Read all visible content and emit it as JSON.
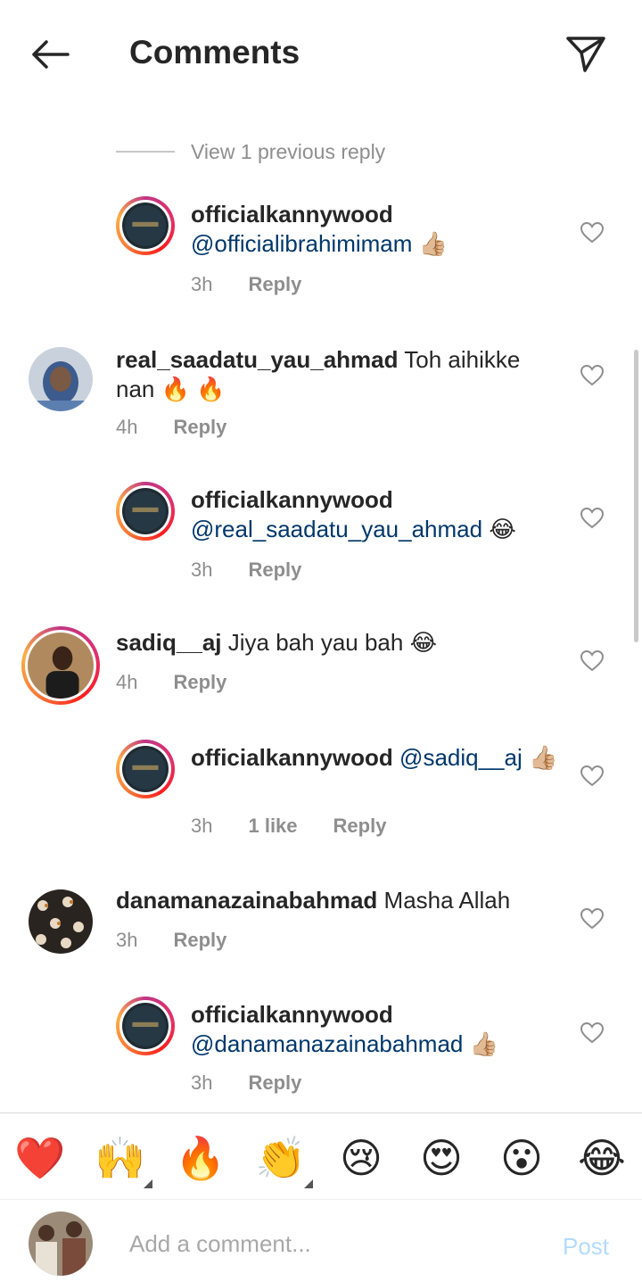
{
  "header": {
    "title": "Comments",
    "back_icon": "arrow-left-icon",
    "share_icon": "paper-plane-icon"
  },
  "view_previous": "View 1 previous reply",
  "comments": [
    {
      "username": "officialkannywood",
      "text": "",
      "mention": "@officialibrahimimam",
      "emoji": "👍🏼",
      "time": "3h",
      "likes": "",
      "reply": "Reply",
      "is_reply": true
    },
    {
      "username": "real_saadatu_yau_ahmad",
      "text": "Toh aihikke nan",
      "mention": "",
      "emoji": "🔥 🔥",
      "time": "4h",
      "likes": "",
      "reply": "Reply",
      "is_reply": false
    },
    {
      "username": "officialkannywood",
      "text": "",
      "mention": "@real_saadatu_yau_ahmad",
      "emoji": "😂",
      "time": "3h",
      "likes": "",
      "reply": "Reply",
      "is_reply": true
    },
    {
      "username": "sadiq__aj",
      "text": "Jiya bah yau bah",
      "mention": "",
      "emoji": "😂",
      "time": "4h",
      "likes": "",
      "reply": "Reply",
      "is_reply": false
    },
    {
      "username": "officialkannywood",
      "text": "",
      "mention": "@sadiq__aj",
      "emoji": "👍🏼",
      "time": "3h",
      "likes": "1 like",
      "reply": "Reply",
      "is_reply": true
    },
    {
      "username": "danamanazainabahmad",
      "text": "Masha Allah",
      "mention": "",
      "emoji": "",
      "time": "3h",
      "likes": "",
      "reply": "Reply",
      "is_reply": false
    },
    {
      "username": "officialkannywood",
      "text": "",
      "mention": "@danamanazainabahmad",
      "emoji": "👍🏼",
      "time": "3h",
      "likes": "",
      "reply": "Reply",
      "is_reply": true
    }
  ],
  "quick_emojis": [
    "❤️",
    "🙌",
    "🔥",
    "👏",
    "😢",
    "😍",
    "😮",
    "😂"
  ],
  "composer": {
    "placeholder": "Add a comment...",
    "post_label": "Post"
  },
  "colors": {
    "mention": "#00376b",
    "post_disabled": "#b3dbff",
    "meta": "#8e8e8e"
  }
}
